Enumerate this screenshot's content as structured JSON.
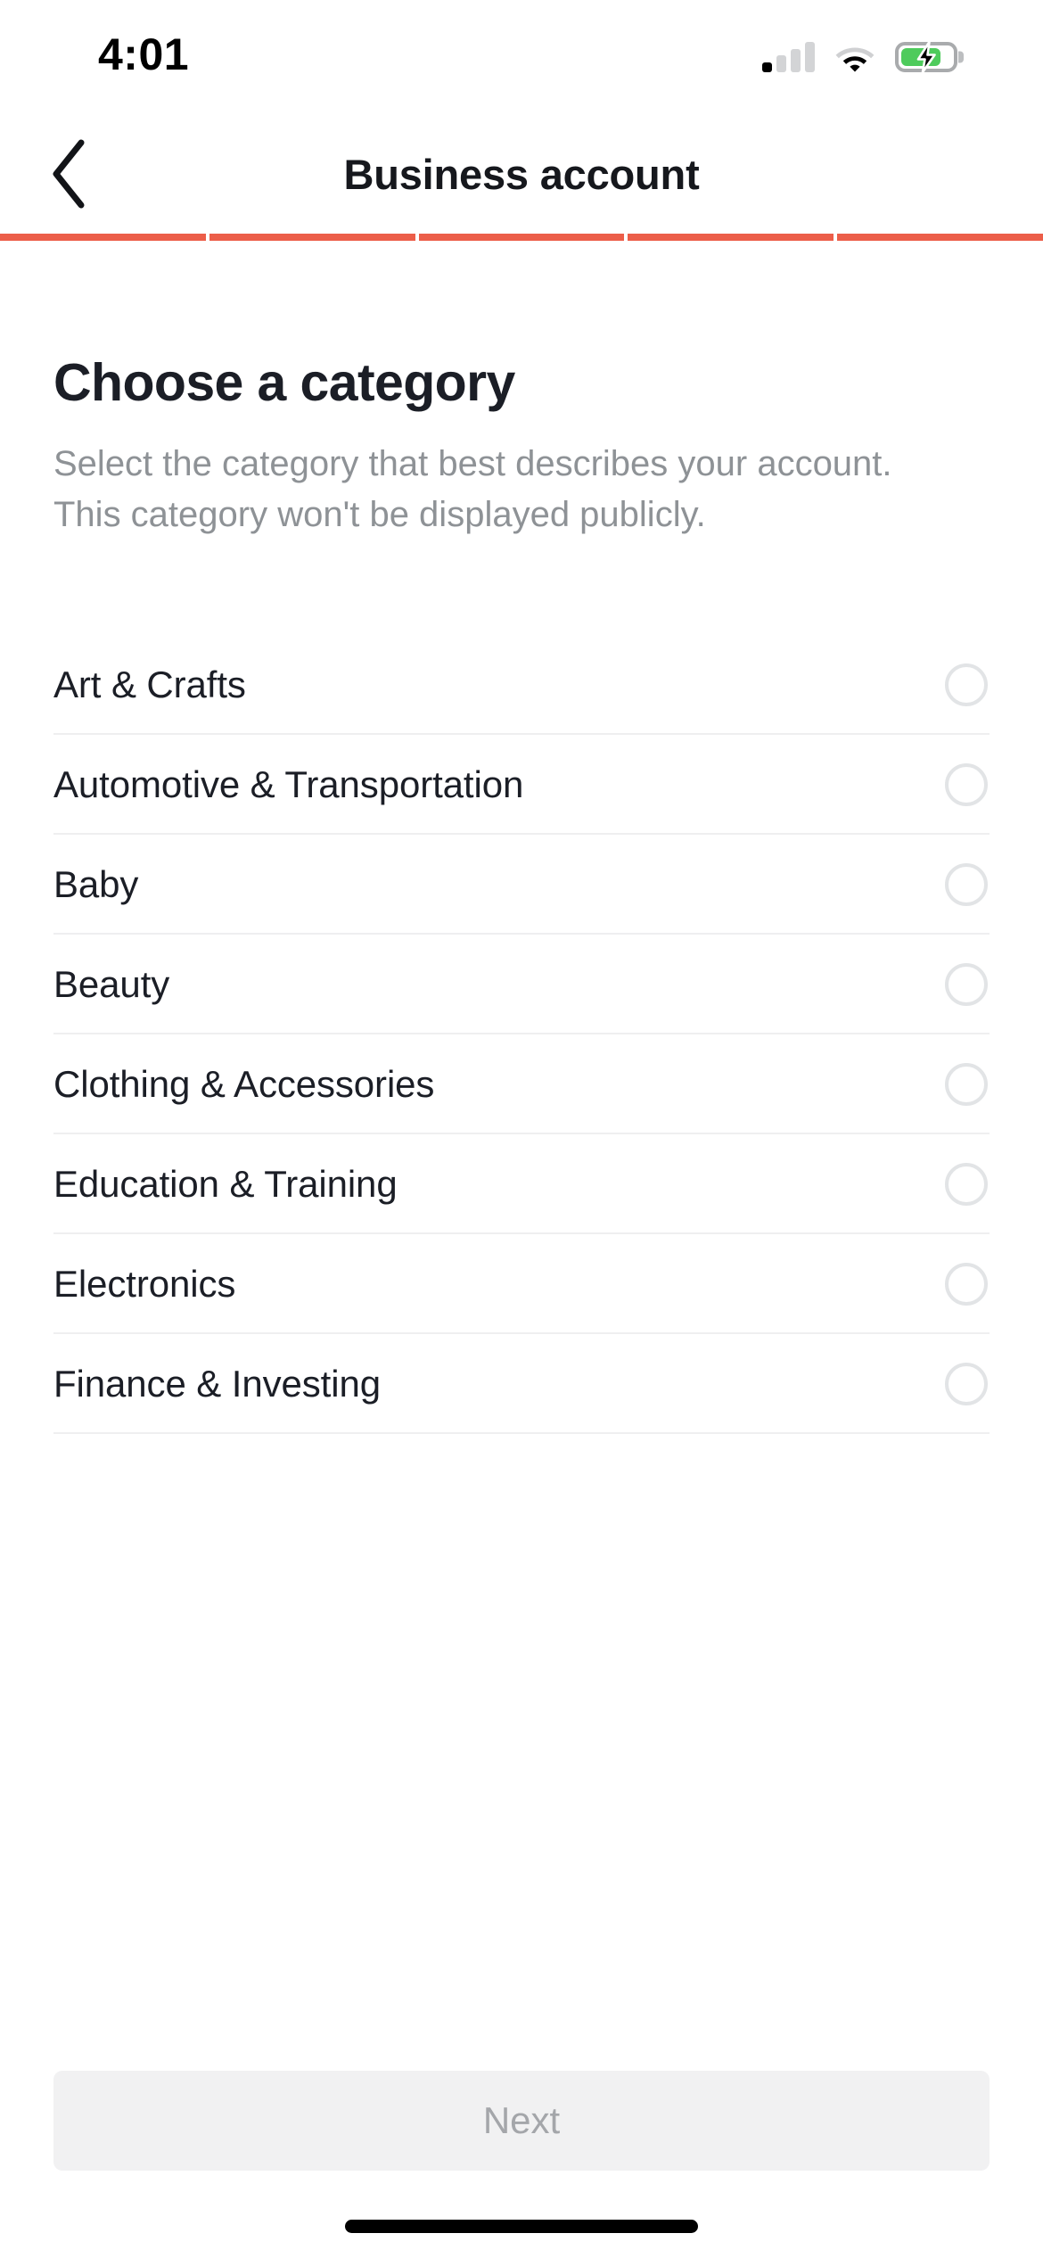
{
  "status_bar": {
    "time": "4:01",
    "signal_icon": "cellular-signal-icon",
    "signal_bars_filled": 1,
    "signal_bars_total": 4,
    "wifi_icon": "wifi-icon",
    "battery_icon": "battery-charging-icon",
    "battery_charging": true,
    "battery_color": "#4ECB5C"
  },
  "nav": {
    "back_icon": "chevron-left-icon",
    "title": "Business account"
  },
  "progress": {
    "total_steps": 5,
    "completed_steps": 5,
    "accent_color": "#EC5E49",
    "segments": [
      {
        "filled": true
      },
      {
        "filled": true
      },
      {
        "filled": true
      },
      {
        "filled": true
      },
      {
        "filled": true
      }
    ]
  },
  "main": {
    "heading": "Choose a category",
    "subtitle": "Select the category that best describes your account. This category won't be displayed publicly.",
    "categories": [
      {
        "label": "Art & Crafts",
        "selected": false
      },
      {
        "label": "Automotive & Transportation",
        "selected": false
      },
      {
        "label": "Baby",
        "selected": false
      },
      {
        "label": "Beauty",
        "selected": false
      },
      {
        "label": "Clothing & Accessories",
        "selected": false
      },
      {
        "label": "Education & Training",
        "selected": false
      },
      {
        "label": "Electronics",
        "selected": false
      },
      {
        "label": "Finance & Investing",
        "selected": false
      }
    ]
  },
  "footer": {
    "next_label": "Next",
    "next_enabled": false
  }
}
